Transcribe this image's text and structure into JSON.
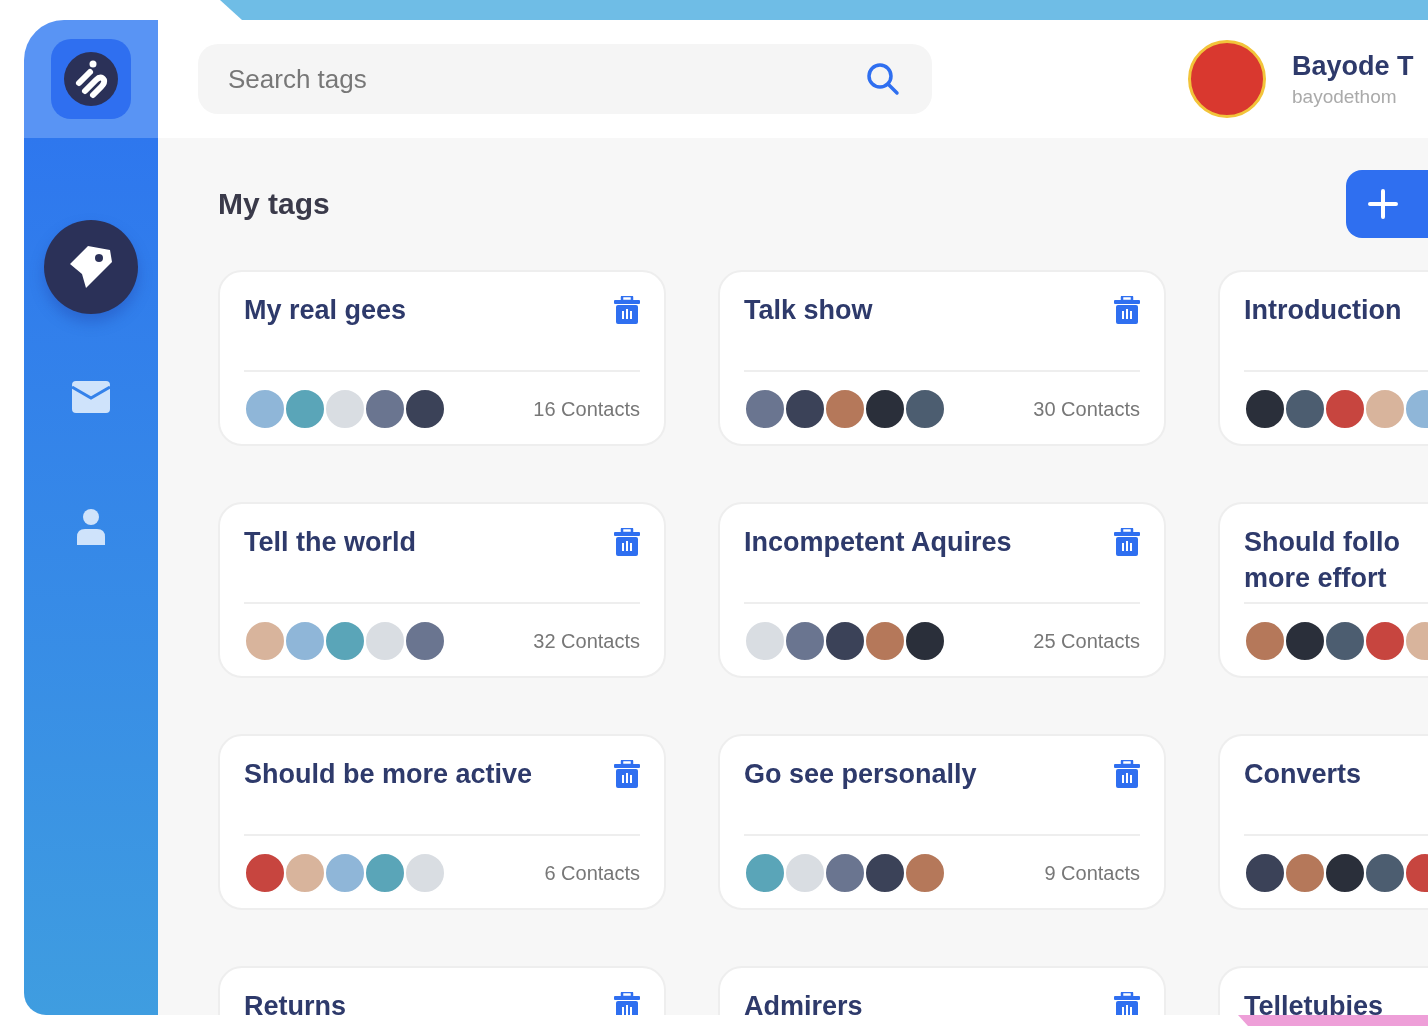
{
  "sidebar": {
    "items": [
      {
        "kind": "tag",
        "selected": true
      },
      {
        "kind": "mail",
        "selected": false
      },
      {
        "kind": "person",
        "selected": false
      }
    ]
  },
  "search": {
    "placeholder": "Search tags"
  },
  "user": {
    "name": "Bayode T",
    "email": "bayodethom"
  },
  "page_title": "My tags",
  "tags": [
    {
      "title": "My real gees",
      "contacts": "16 Contacts",
      "members_shown": true
    },
    {
      "title": "Talk show",
      "contacts": "30 Contacts",
      "members_shown": true
    },
    {
      "title": "Introduction",
      "members_shown": true
    },
    {
      "title": "Tell the world",
      "contacts": "32 Contacts",
      "members_shown": true
    },
    {
      "title": "Incompetent Aquires",
      "contacts": "25 Contacts",
      "members_shown": true
    },
    {
      "title": "Should follo\nmore effort",
      "members_shown": true
    },
    {
      "title": "Should be more active",
      "contacts": "6 Contacts",
      "members_shown": true
    },
    {
      "title": "Go see personally",
      "contacts": "9 Contacts",
      "members_shown": true
    },
    {
      "title": "Converts",
      "members_shown": true
    },
    {
      "title": "Returns"
    },
    {
      "title": "Admirers"
    },
    {
      "title": "Telletubies"
    }
  ]
}
